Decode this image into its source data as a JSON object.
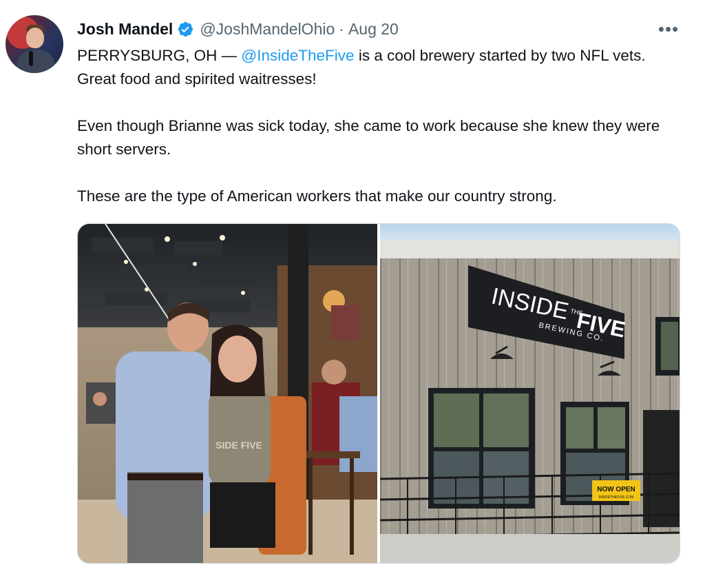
{
  "author": {
    "name": "Josh Mandel",
    "handle": "@JoshMandelOhio",
    "date": "Aug 20",
    "separator": "·"
  },
  "more_label": "•••",
  "tweet": {
    "line1_prefix": "PERRYSBURG, OH — ",
    "mention": "@InsideTheFive",
    "line1_suffix": " is a cool brewery started by two NFL vets. Great food and spirited waitresses!",
    "para2": "Even though Brianne was sick today, she came to work because she knew they were short servers.",
    "para3": "These are the type of American workers that make our country strong."
  },
  "media": {
    "left_photo": {
      "shirt_text": "SIDE FIVE"
    },
    "right_photo": {
      "sign_line1": "INSIDE",
      "sign_the": "THE",
      "sign_five": "FIVE",
      "sign_line2": "BREWING CO.",
      "banner_text": "NOW OPEN",
      "banner_sub": "INSIDETHEFIVE.COM"
    }
  },
  "colors": {
    "link": "#1d9bf0",
    "verified": "#1d9bf0",
    "secondary_text": "#536471"
  }
}
